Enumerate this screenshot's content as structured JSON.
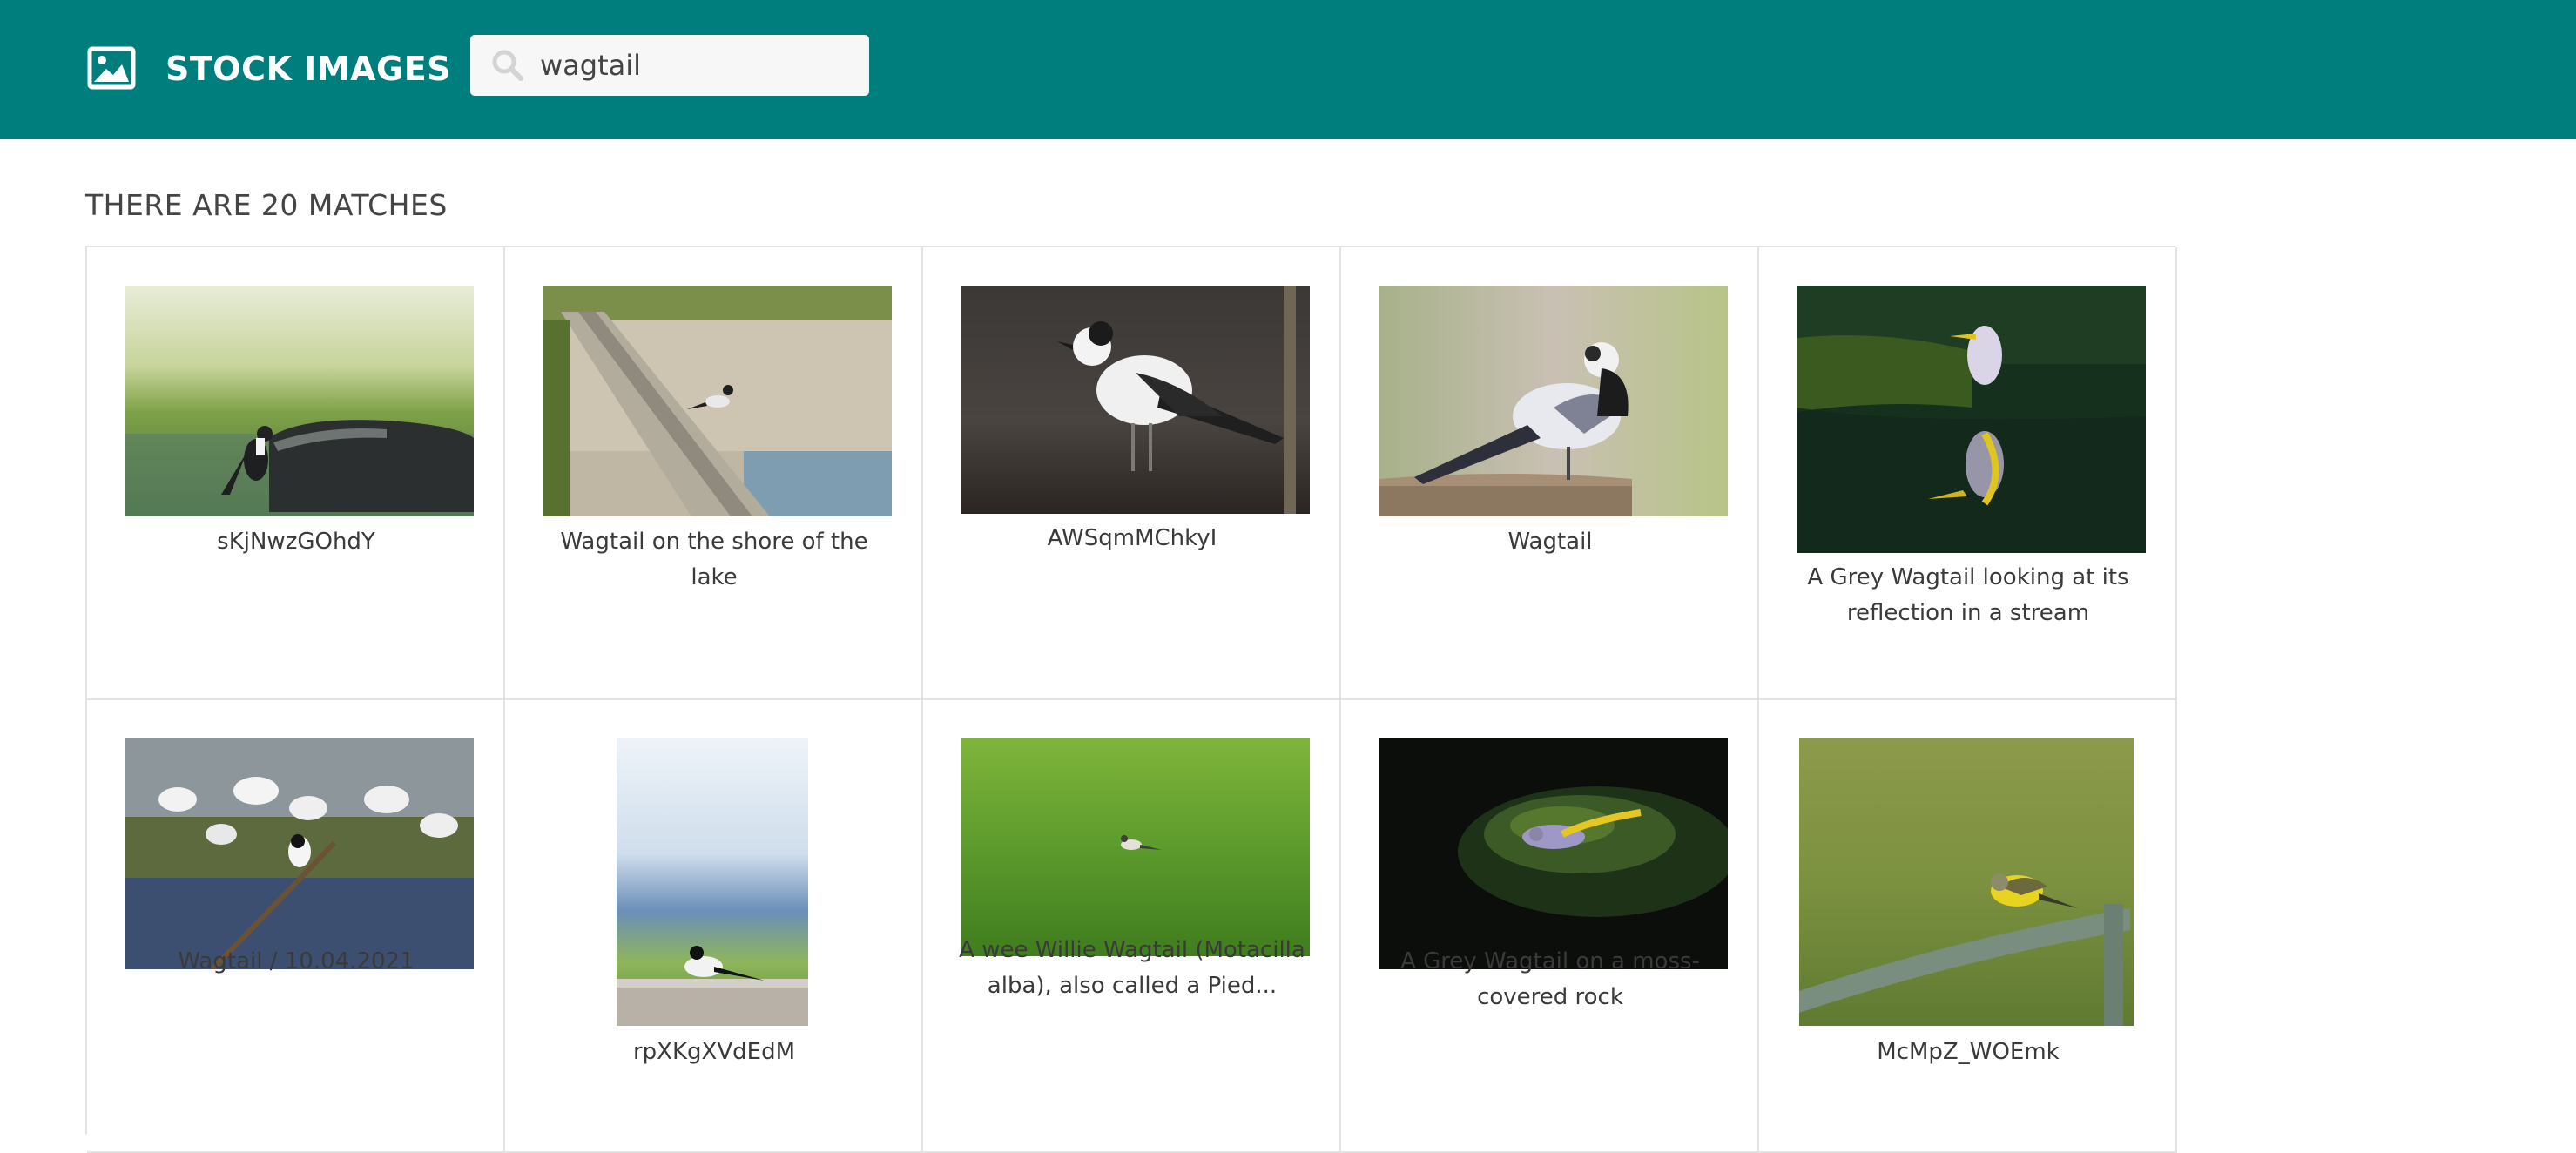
{
  "header": {
    "title": "STOCK IMAGES",
    "logo_icon": "image-icon",
    "search_icon": "search-icon",
    "background": "#007e7e"
  },
  "search": {
    "value": "wagtail",
    "placeholder": ""
  },
  "results": {
    "heading": "THERE ARE 20 MATCHES",
    "items": [
      {
        "caption": "sKjNwzGOhdY"
      },
      {
        "caption": "Wagtail on the shore of the lake"
      },
      {
        "caption": "AWSqmMChkyI"
      },
      {
        "caption": "Wagtail"
      },
      {
        "caption": "A Grey Wagtail looking at its reflection in a stream"
      },
      {
        "caption": "Wagtail / 10.04.2021"
      },
      {
        "caption": "rpXKgXVdEdM"
      },
      {
        "caption": "A wee Willie Wagtail (Motacilla alba), also called a Pied..."
      },
      {
        "caption": "A Grey Wagtail on a moss-covered rock"
      },
      {
        "caption": "McMpZ_WOEmk"
      }
    ]
  }
}
